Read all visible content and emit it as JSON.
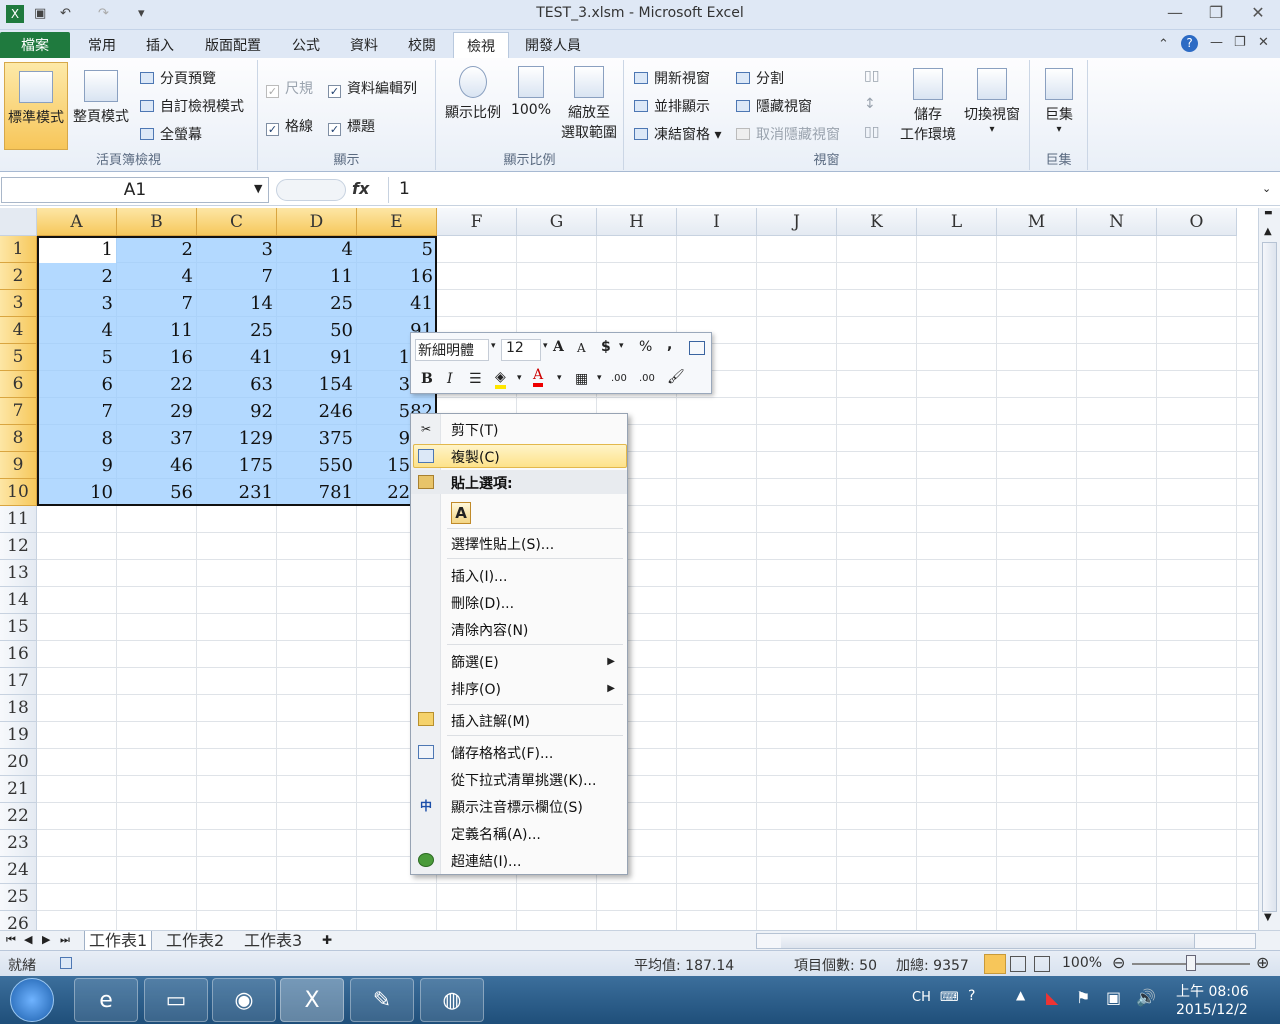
{
  "window": {
    "title": "TEST_3.xlsm  -  Microsoft Excel"
  },
  "tabs": [
    "檔案",
    "常用",
    "插入",
    "版面配置",
    "公式",
    "資料",
    "校閱",
    "檢視",
    "開發人員"
  ],
  "ribbon": {
    "workbook_views": {
      "label": "活頁簿檢視",
      "normal": "標準模式",
      "page_layout": "整頁模式",
      "page_break": "分頁預覽",
      "custom": "自訂檢視模式",
      "full_screen": "全螢幕"
    },
    "show": {
      "label": "顯示",
      "ruler": "尺規",
      "formula_bar": "資料編輯列",
      "gridlines": "格線",
      "headings": "標題"
    },
    "zoom": {
      "label": "顯示比例",
      "zoom": "顯示比例",
      "hundred": "100%",
      "zoom_sel_1": "縮放至",
      "zoom_sel_2": "選取範圍"
    },
    "window": {
      "label": "視窗",
      "new_window": "開新視窗",
      "arrange": "並排顯示",
      "freeze": "凍結窗格",
      "split": "分割",
      "hide": "隱藏視窗",
      "unhide": "取消隱藏視窗",
      "save_ws_1": "儲存",
      "save_ws_2": "工作環境",
      "switch": "切換視窗"
    },
    "macros": {
      "label": "巨集",
      "macros": "巨集"
    }
  },
  "formula": {
    "namebox": "A1",
    "fx": "fx",
    "value": "1"
  },
  "columns": [
    "A",
    "B",
    "C",
    "D",
    "E",
    "F",
    "G",
    "H",
    "I",
    "J",
    "K",
    "L",
    "M",
    "N",
    "O"
  ],
  "rows": [
    "1",
    "2",
    "3",
    "4",
    "5",
    "6",
    "7",
    "8",
    "9",
    "10",
    "11",
    "12",
    "13",
    "14",
    "15",
    "16",
    "17",
    "18",
    "19",
    "20",
    "21",
    "22",
    "23",
    "24",
    "25",
    "26"
  ],
  "cells": [
    [
      "1",
      "2",
      "3",
      "4",
      "5"
    ],
    [
      "2",
      "4",
      "7",
      "11",
      "16"
    ],
    [
      "3",
      "7",
      "14",
      "25",
      "41"
    ],
    [
      "4",
      "11",
      "25",
      "50",
      "91"
    ],
    [
      "5",
      "16",
      "41",
      "91",
      "182"
    ],
    [
      "6",
      "22",
      "63",
      "154",
      "336"
    ],
    [
      "7",
      "29",
      "92",
      "246",
      "582"
    ],
    [
      "8",
      "37",
      "129",
      "375",
      "957"
    ],
    [
      "9",
      "46",
      "175",
      "550",
      "1507"
    ],
    [
      "10",
      "56",
      "231",
      "781",
      "2288"
    ]
  ],
  "mini_toolbar": {
    "font": "新細明體",
    "size": "12",
    "grow": "A",
    "shrink": "A",
    "currency": "$",
    "percent": "%",
    "comma": ",",
    "bold": "B",
    "italic": "I",
    "font_color": "A",
    "inc_dec": ".00",
    "dec_dec": ".00"
  },
  "context_menu": {
    "cut": "剪下(T)",
    "copy": "複製(C)",
    "paste_options": "貼上選項:",
    "paste_icon": "A",
    "paste_special": "選擇性貼上(S)...",
    "insert": "插入(I)...",
    "delete": "刪除(D)...",
    "clear": "清除內容(N)",
    "filter": "篩選(E)",
    "sort": "排序(O)",
    "comment": "插入註解(M)",
    "format": "儲存格格式(F)...",
    "pick": "從下拉式清單挑選(K)...",
    "phonetic": "顯示注音標示欄位(S)",
    "define_name": "定義名稱(A)...",
    "hyperlink": "超連結(I)..."
  },
  "sheets": [
    "工作表1",
    "工作表2",
    "工作表3"
  ],
  "status": {
    "ready": "就緒",
    "average": "平均值: 187.14",
    "count": "項目個數: 50",
    "sum": "加總: 9357",
    "zoom": "100%"
  },
  "taskbar": {
    "ime": "CH",
    "time": "上午 08:06",
    "date": "2015/12/2"
  }
}
